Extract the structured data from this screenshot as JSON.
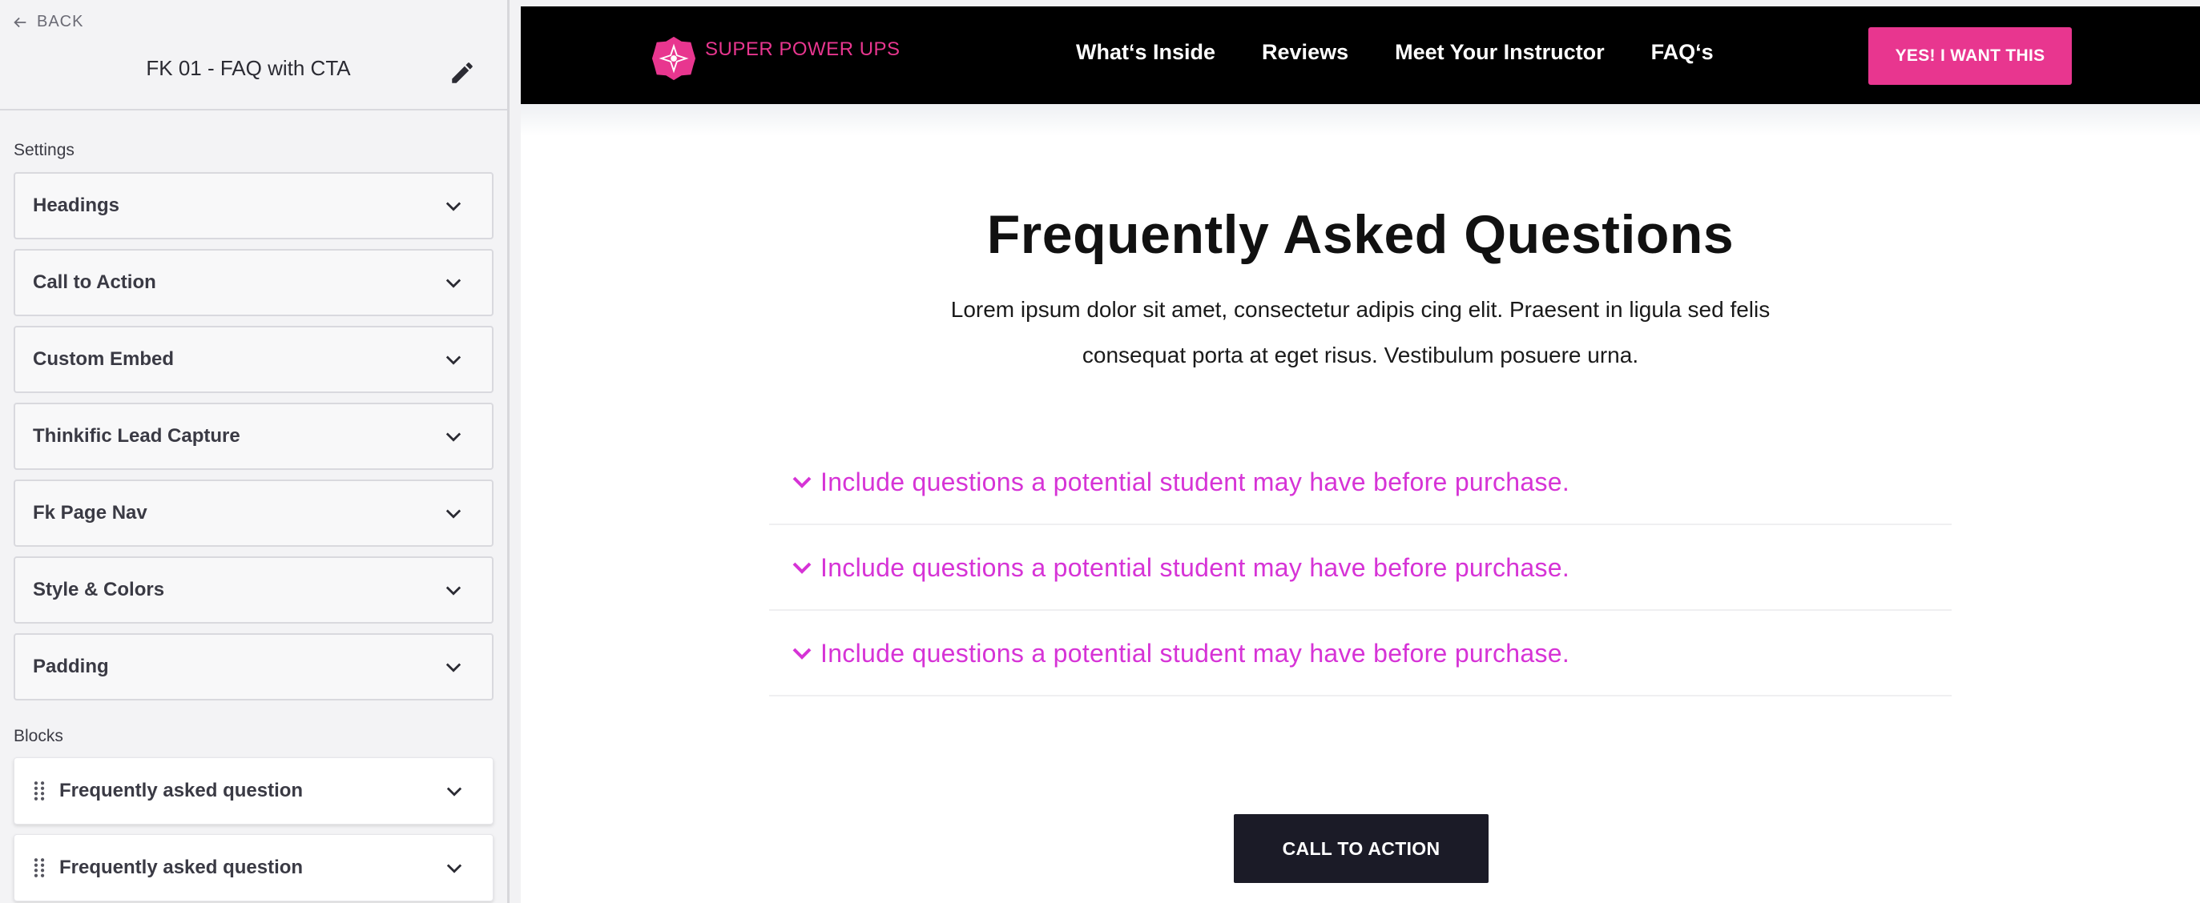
{
  "sidebar": {
    "back_label": "BACK",
    "title": "FK 01 - FAQ with CTA",
    "settings_label": "Settings",
    "settings_panels": [
      {
        "label": "Headings"
      },
      {
        "label": "Call to Action"
      },
      {
        "label": "Custom Embed"
      },
      {
        "label": "Thinkific Lead Capture"
      },
      {
        "label": "Fk Page Nav"
      },
      {
        "label": "Style & Colors"
      },
      {
        "label": "Padding"
      }
    ],
    "blocks_label": "Blocks",
    "blocks": [
      {
        "label": "Frequently asked question"
      },
      {
        "label": "Frequently asked question"
      }
    ]
  },
  "preview": {
    "brand": {
      "name": "SUPER POWER UPS",
      "color": "#e8368f"
    },
    "nav_links": [
      "What‘s Inside",
      "Reviews",
      "Meet Your Instructor",
      "FAQ‘s"
    ],
    "top_cta": "YES! I WANT THIS",
    "heading": "Frequently Asked Questions",
    "subtext": "Lorem ipsum dolor sit amet, consectetur adipis cing elit. Praesent in ligula sed felis consequat porta at eget risus. Vestibulum posuere urna.",
    "faq_items": [
      {
        "question": "Include questions a potential student may have before purchase."
      },
      {
        "question": "Include questions a potential student may have before purchase."
      },
      {
        "question": "Include questions a potential student may have before purchase."
      }
    ],
    "bottom_cta": "CALL TO ACTION",
    "colors": {
      "accent": "#e8368f",
      "question": "#d633d6",
      "navbar": "#000000",
      "cta_dark": "#1b1b27"
    }
  }
}
